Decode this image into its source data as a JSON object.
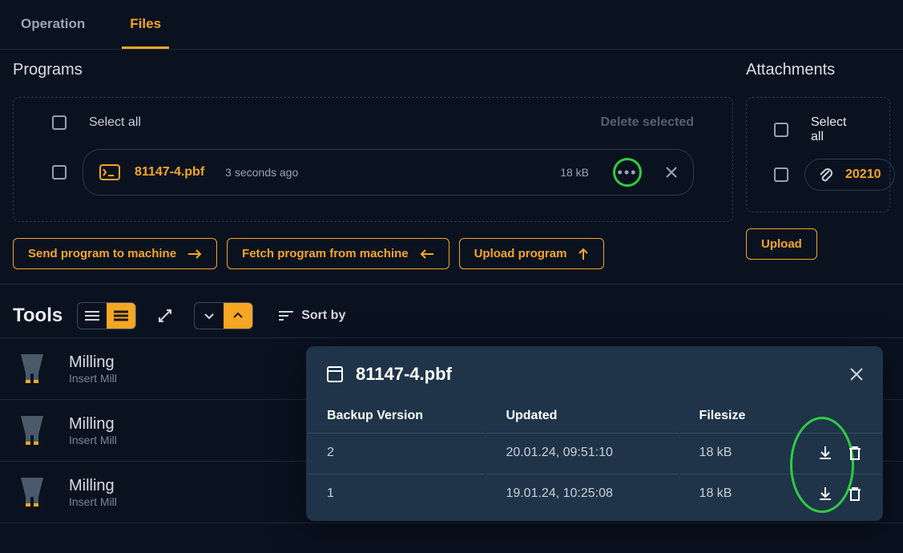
{
  "tabs": {
    "operation": "Operation",
    "files": "Files"
  },
  "programs": {
    "title": "Programs",
    "select_all": "Select all",
    "delete_selected": "Delete selected",
    "file": {
      "name": "81147-4.pbf",
      "age": "3 seconds ago",
      "size": "18 kB"
    },
    "buttons": {
      "send": "Send program to machine",
      "fetch": "Fetch program from machine",
      "upload": "Upload program"
    }
  },
  "attachments": {
    "title": "Attachments",
    "select_all": "Select all",
    "file": {
      "name": "20210"
    },
    "upload": "Upload"
  },
  "tools": {
    "title": "Tools",
    "sort_label": "Sort by",
    "items": [
      {
        "name": "Milling",
        "sub": "Insert Mill"
      },
      {
        "name": "Milling",
        "sub": "Insert Mill"
      },
      {
        "name": "Milling",
        "sub": "Insert Mill"
      }
    ]
  },
  "modal": {
    "filename": "81147-4.pbf",
    "columns": {
      "version": "Backup Version",
      "updated": "Updated",
      "filesize": "Filesize"
    },
    "rows": [
      {
        "version": "2",
        "updated": "20.01.24, 09:51:10",
        "size": "18 kB"
      },
      {
        "version": "1",
        "updated": "19.01.24, 10:25:08",
        "size": "18 kB"
      }
    ]
  }
}
